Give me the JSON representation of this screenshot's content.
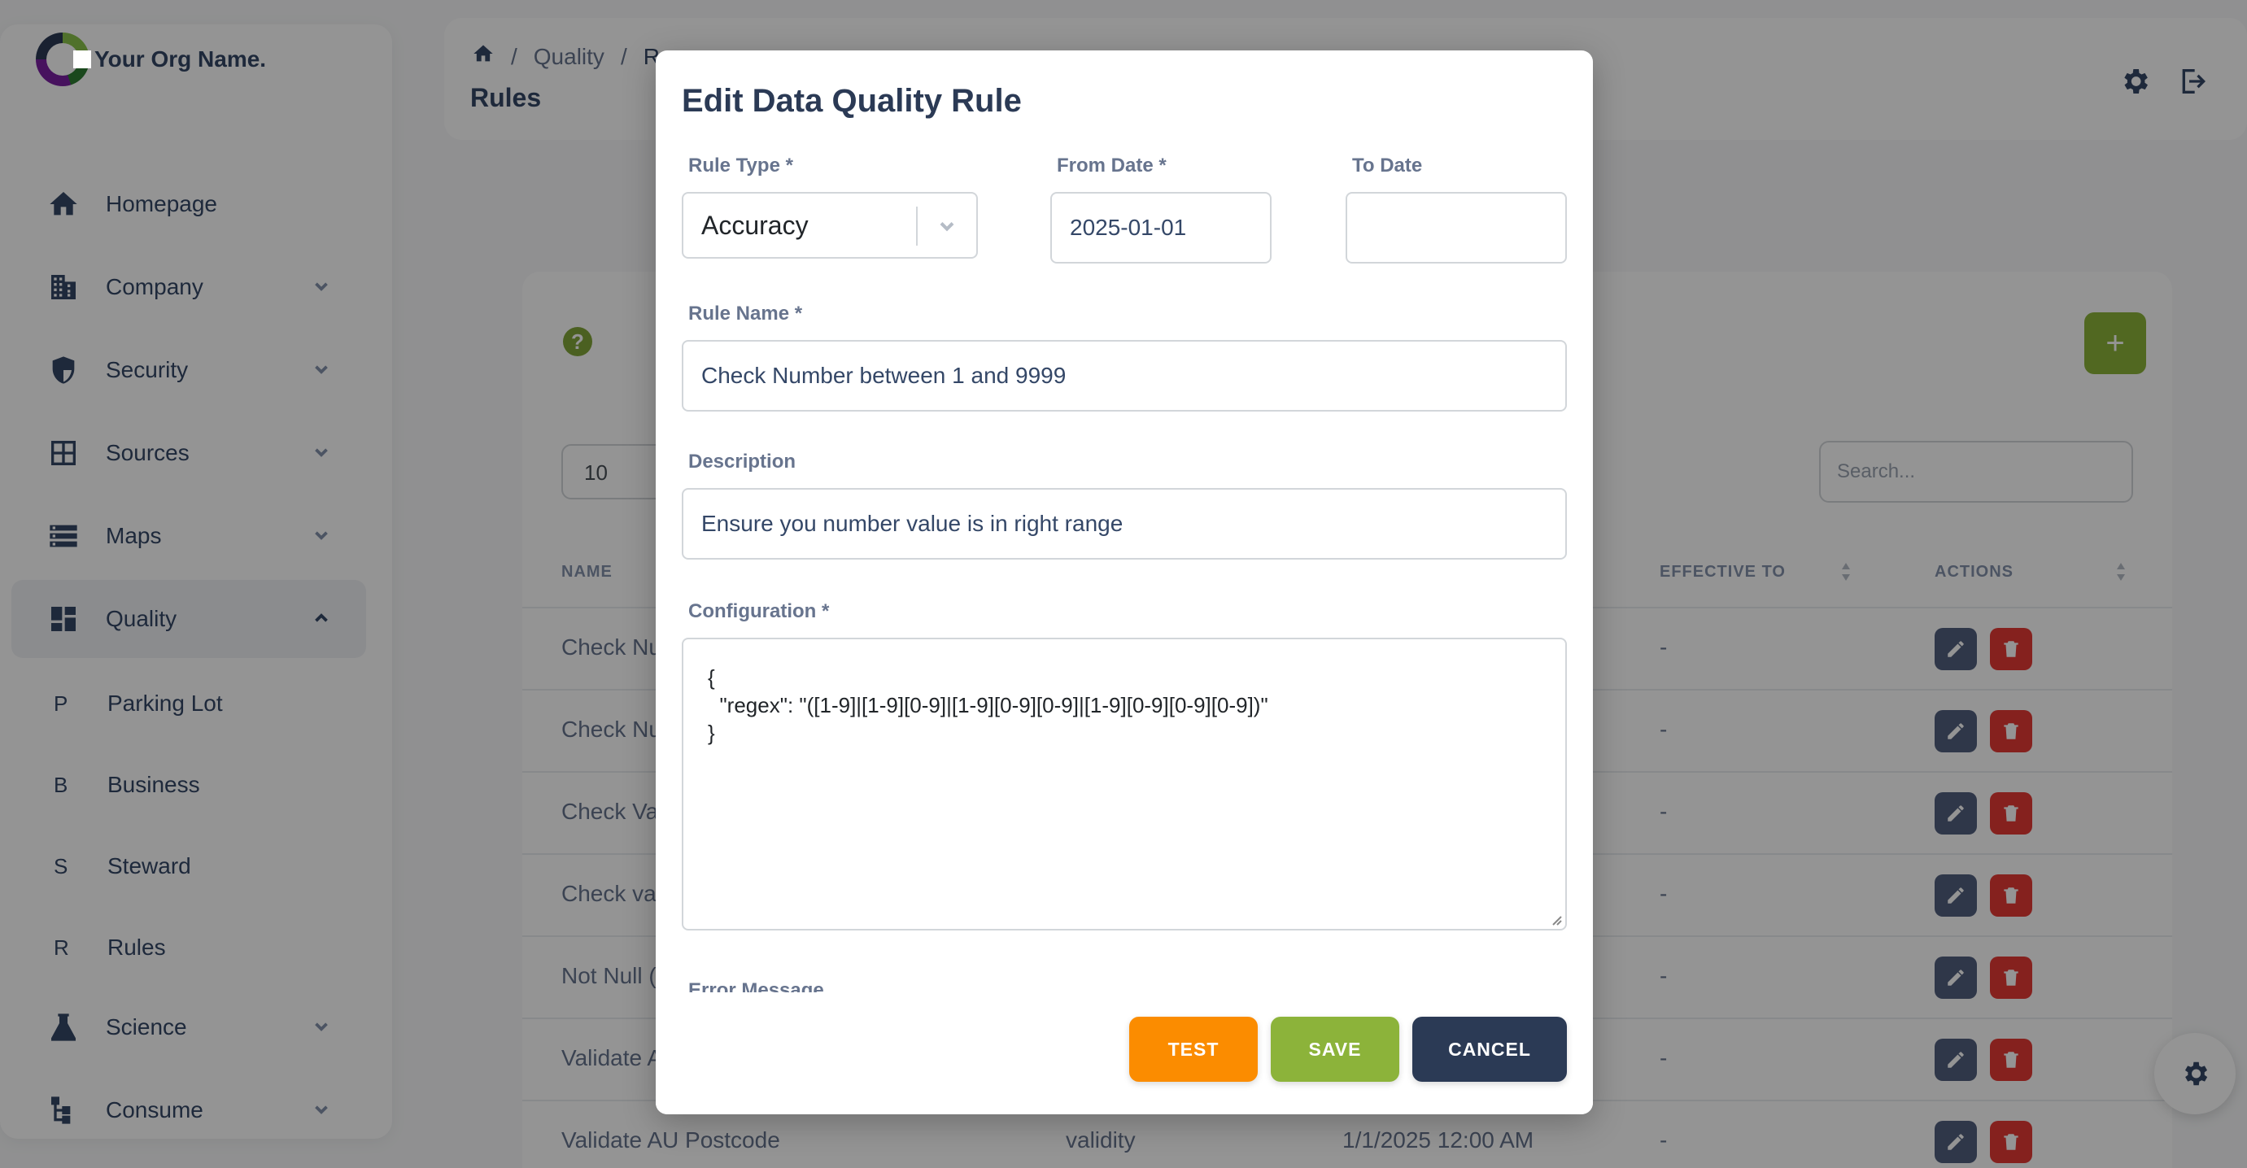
{
  "brand": {
    "name": "Your Org Name."
  },
  "sidebar": {
    "items": [
      {
        "label": "Homepage",
        "icon": "home-icon"
      },
      {
        "label": "Company",
        "icon": "building-icon"
      },
      {
        "label": "Security",
        "icon": "shield-icon"
      },
      {
        "label": "Sources",
        "icon": "grid-icon"
      },
      {
        "label": "Maps",
        "icon": "list-icon"
      },
      {
        "label": "Quality",
        "icon": "dashboard-icon"
      }
    ],
    "sub_items": [
      {
        "letter": "P",
        "label": "Parking Lot"
      },
      {
        "letter": "B",
        "label": "Business"
      },
      {
        "letter": "S",
        "label": "Steward"
      },
      {
        "letter": "R",
        "label": "Rules"
      }
    ],
    "bottom_items": [
      {
        "label": "Science",
        "icon": "flask-icon"
      },
      {
        "label": "Consume",
        "icon": "hierarchy-icon"
      }
    ]
  },
  "header": {
    "breadcrumb": [
      "Quality",
      "R"
    ],
    "page_title": "Rules"
  },
  "table": {
    "page_size": "10",
    "search_placeholder": "Search...",
    "columns": {
      "name": "NAME",
      "effective_to": "EFFECTIVE TO",
      "actions": "ACTIONS"
    },
    "rows": [
      {
        "name": "Check Nu",
        "type": "",
        "from": "",
        "to": "-"
      },
      {
        "name": "Check Nu",
        "type": "",
        "from": "",
        "to": "-"
      },
      {
        "name": "Check Va",
        "type": "",
        "from": "",
        "to": "-"
      },
      {
        "name": "Check va",
        "type": "",
        "from": "",
        "to": "-"
      },
      {
        "name": "Not Null (",
        "type": "",
        "from": "",
        "to": "-"
      },
      {
        "name": "Validate A",
        "type": "",
        "from": "",
        "to": "-"
      },
      {
        "name": "Validate AU Postcode",
        "type": "validity",
        "from": "1/1/2025 12:00 AM",
        "to": "-"
      }
    ]
  },
  "modal": {
    "title": "Edit Data Quality Rule",
    "rule_type": {
      "label": "Rule Type *",
      "value": "Accuracy"
    },
    "from_date": {
      "label": "From Date *",
      "value": "2025-01-01"
    },
    "to_date": {
      "label": "To Date",
      "value": ""
    },
    "rule_name": {
      "label": "Rule Name *",
      "value": "Check Number between 1 and 9999"
    },
    "description": {
      "label": "Description",
      "value": "Ensure you number value is in right range"
    },
    "configuration": {
      "label": "Configuration *",
      "value": "{\n  \"regex\": \"([1-9]|[1-9][0-9]|[1-9][0-9][0-9]|[1-9][0-9][0-9][0-9])\"\n}"
    },
    "error_message": {
      "label": "Error Message"
    },
    "buttons": {
      "test": "TEST",
      "save": "SAVE",
      "cancel": "CANCEL"
    }
  },
  "colors": {
    "primary_dark": "#2b3a55",
    "accent_green": "#8cb33a",
    "accent_orange": "#fb8c00",
    "danger": "#e53935"
  }
}
